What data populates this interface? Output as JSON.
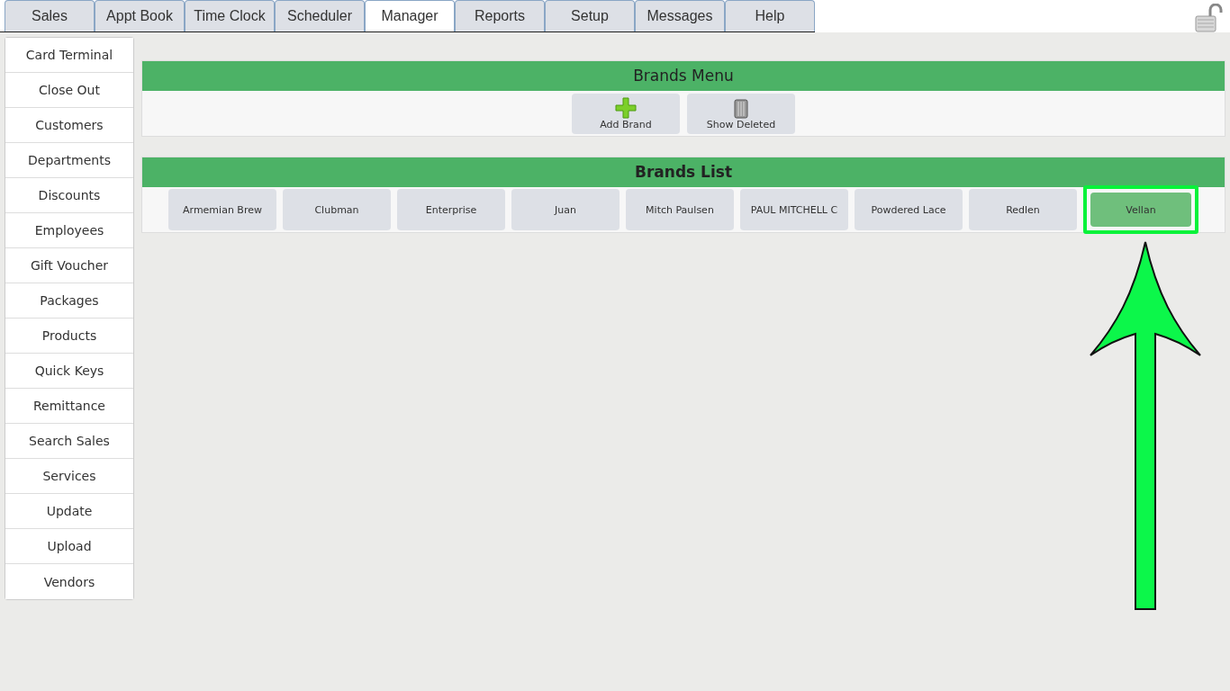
{
  "tabs": [
    {
      "label": "Sales",
      "selected": false
    },
    {
      "label": "Appt Book",
      "selected": false
    },
    {
      "label": "Time Clock",
      "selected": false
    },
    {
      "label": "Scheduler",
      "selected": false
    },
    {
      "label": "Manager",
      "selected": true
    },
    {
      "label": "Reports",
      "selected": false
    },
    {
      "label": "Setup",
      "selected": false
    },
    {
      "label": "Messages",
      "selected": false
    },
    {
      "label": "Help",
      "selected": false
    }
  ],
  "sidebar": {
    "items": [
      "Card Terminal",
      "Close Out",
      "Customers",
      "Departments",
      "Discounts",
      "Employees",
      "Gift Voucher",
      "Packages",
      "Products",
      "Quick Keys",
      "Remittance",
      "Search Sales",
      "Services",
      "Update",
      "Upload",
      "Vendors"
    ]
  },
  "brands_menu": {
    "title": "Brands Menu",
    "buttons": [
      {
        "label": "Add Brand",
        "kind": "add"
      },
      {
        "label": "Show Deleted",
        "kind": "trash"
      }
    ]
  },
  "brands_list": {
    "title": "Brands List",
    "items": [
      {
        "label": "Armemian Brew",
        "highlighted": false
      },
      {
        "label": "Clubman",
        "highlighted": false
      },
      {
        "label": "Enterprise",
        "highlighted": false
      },
      {
        "label": "Juan",
        "highlighted": false
      },
      {
        "label": "Mitch Paulsen",
        "highlighted": false
      },
      {
        "label": "PAUL MITCHELL C",
        "highlighted": false
      },
      {
        "label": "Powdered Lace",
        "highlighted": false
      },
      {
        "label": "Redlen",
        "highlighted": false
      },
      {
        "label": "Vellan",
        "highlighted": true
      }
    ]
  }
}
